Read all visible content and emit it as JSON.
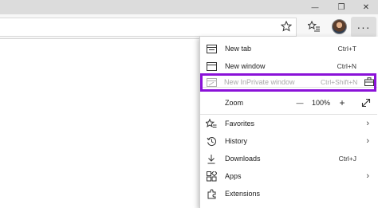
{
  "window": {
    "minimize_glyph": "—",
    "restore_glyph": "❐",
    "close_glyph": "✕"
  },
  "toolbar": {
    "favorite_icon": "star-outline-icon",
    "favorites_icon": "favorites-list-icon",
    "settings_glyph": "···"
  },
  "menu": {
    "new_tab": {
      "label": "New tab",
      "shortcut": "Ctrl+T"
    },
    "new_window": {
      "label": "New window",
      "shortcut": "Ctrl+N"
    },
    "new_inprivate": {
      "label": "New InPrivate window",
      "shortcut": "Ctrl+Shift+N"
    },
    "zoom": {
      "label": "Zoom",
      "minus": "—",
      "value": "100%",
      "plus": "+"
    },
    "favorites": {
      "label": "Favorites"
    },
    "history": {
      "label": "History"
    },
    "downloads": {
      "label": "Downloads",
      "shortcut": "Ctrl+J"
    },
    "apps": {
      "label": "Apps"
    },
    "extensions": {
      "label": "Extensions"
    },
    "chevron": "›"
  },
  "colors": {
    "highlight_border": "#8a12d8",
    "disabled_text": "#a8a8a8"
  }
}
